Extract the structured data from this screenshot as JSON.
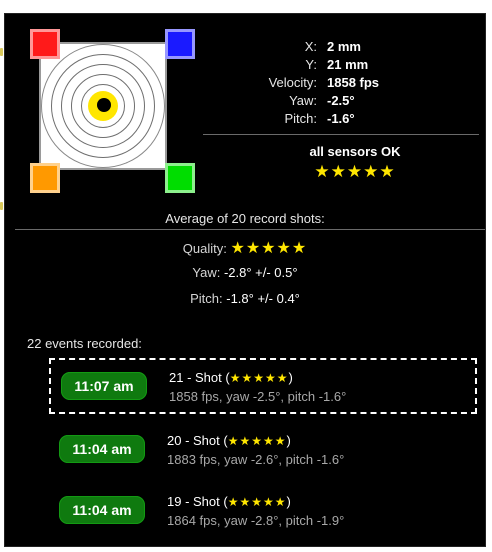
{
  "colors": {
    "corner_top_left": "#ff1a1a",
    "corner_top_right": "#1a1aff",
    "corner_bottom_left": "#ff9900",
    "corner_bottom_right": "#00dd00",
    "star": "#ffe600",
    "time_badge": "#0f7a0f"
  },
  "target": {
    "icon": "target-icon"
  },
  "readout": {
    "x_label": "X:",
    "x_value": "2 mm",
    "y_label": "Y:",
    "y_value": "21 mm",
    "velocity_label": "Velocity:",
    "velocity_value": "1858 fps",
    "yaw_label": "Yaw:",
    "yaw_value": "-2.5°",
    "pitch_label": "Pitch:",
    "pitch_value": "-1.6°"
  },
  "status": {
    "text": "all sensors OK",
    "stars": "★★★★★"
  },
  "average": {
    "title": "Average of 20 record shots:",
    "quality_label": "Quality:",
    "quality_stars": "★★★★★",
    "yaw_label": "Yaw:",
    "yaw_value": "-2.8° +/- 0.5°",
    "pitch_label": "Pitch:",
    "pitch_value": "-1.8° +/- 0.4°"
  },
  "events": {
    "count_text": "22 events recorded:",
    "items": [
      {
        "time": "11:07 am",
        "title_prefix": "21 - Shot (",
        "stars": "★★★★★",
        "title_suffix": ")",
        "detail": "1858 fps, yaw -2.5°, pitch -1.6°",
        "selected": true
      },
      {
        "time": "11:04 am",
        "title_prefix": "20 - Shot (",
        "stars": "★★★★★",
        "title_suffix": ")",
        "detail": "1883 fps, yaw -2.6°, pitch -1.6°",
        "selected": false
      },
      {
        "time": "11:04 am",
        "title_prefix": "19 - Shot (",
        "stars": "★★★★★",
        "title_suffix": ")",
        "detail": "1864 fps, yaw -2.8°, pitch -1.9°",
        "selected": false
      }
    ]
  }
}
